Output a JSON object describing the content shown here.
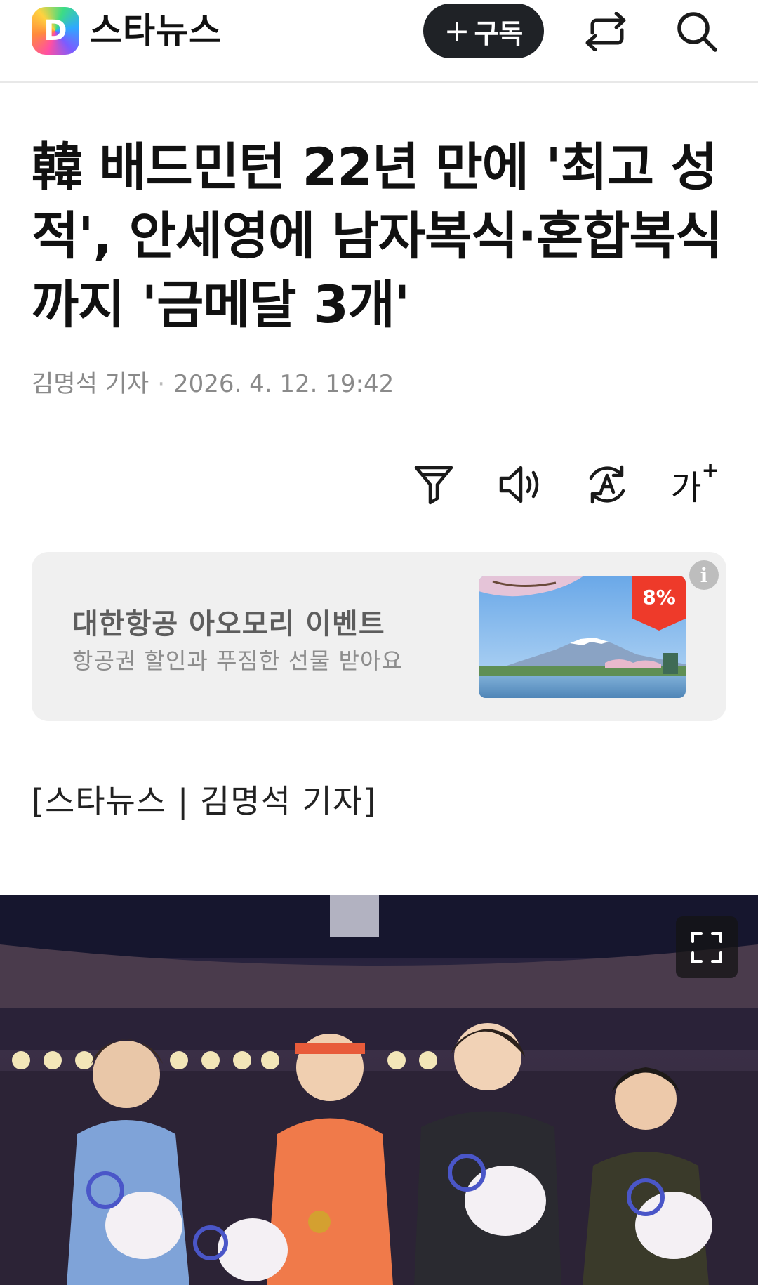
{
  "header": {
    "logo_letter": "D",
    "press_name": "스타뉴스",
    "subscribe_label": "구독",
    "share_icon": "share-icon",
    "search_icon": "search-icon"
  },
  "article": {
    "title": "韓 배드민턴 22년 만에 '최고 성적', 안세영에 남자복식·혼합복식까지 '금메달 3개'",
    "reporter": "김명석 기자",
    "datetime": "2026. 4. 12. 19:42",
    "byline": "[스타뉴스 | 김명석 기자]"
  },
  "tools": {
    "summary_icon": "summary-filter-icon",
    "audio_icon": "speaker-icon",
    "translate_icon": "translate-icon",
    "fontsize_label": "가"
  },
  "ad": {
    "title": "대한항공 아오모리 이벤트",
    "description": "항공권 할인과 푸짐한 선물 받아요",
    "badge": "8%",
    "info_label": "i"
  },
  "colors": {
    "subscribe_bg": "#1f2226",
    "ad_bg": "#f0f0f0",
    "badge": "#ee3a2a"
  }
}
